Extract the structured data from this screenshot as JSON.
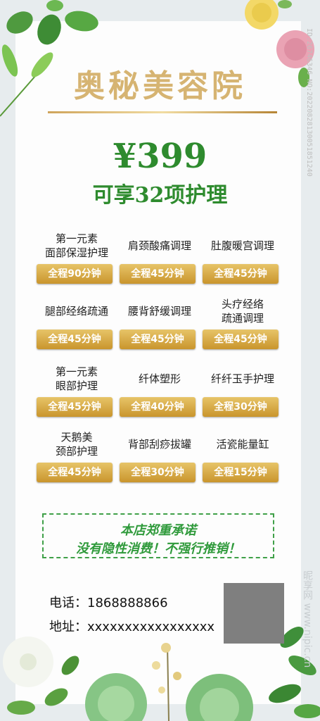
{
  "title": "奥秘美容院",
  "price": "¥399",
  "subtitle": "可享32项护理",
  "services": [
    {
      "name": "第一元素\n面部保湿护理",
      "duration": "全程90分钟"
    },
    {
      "name": "肩颈酸痛调理",
      "duration": "全程45分钟"
    },
    {
      "name": "肚腹暖宫调理",
      "duration": "全程45分钟"
    },
    {
      "name": "腿部经络疏通",
      "duration": "全程45分钟"
    },
    {
      "name": "腰背舒缓调理",
      "duration": "全程45分钟"
    },
    {
      "name": "头疗经络\n疏通调理",
      "duration": "全程45分钟"
    },
    {
      "name": "第一元素\n眼部护理",
      "duration": "全程45分钟"
    },
    {
      "name": "纤体塑形",
      "duration": "全程40分钟"
    },
    {
      "name": "纤纤玉手护理",
      "duration": "全程30分钟"
    },
    {
      "name": "天鹅美\n颈部护理",
      "duration": "全程45分钟"
    },
    {
      "name": "背部刮痧拔罐",
      "duration": "全程30分钟"
    },
    {
      "name": "活瓷能量缸",
      "duration": "全程15分钟"
    }
  ],
  "promise": {
    "line1": "本店郑重承诺",
    "line2": "没有隐性消费！不强行推销！"
  },
  "contact": {
    "phone": "电话：1868888866",
    "address": "地址：xxxxxxxxxxxxxxxxx"
  },
  "watermark": {
    "id": "ID:26746346 NO:20220828130051851240",
    "site": "昵享网 www.nipic.cn"
  },
  "colors": {
    "gold": "#d6b472",
    "green": "#2e8b2e"
  }
}
